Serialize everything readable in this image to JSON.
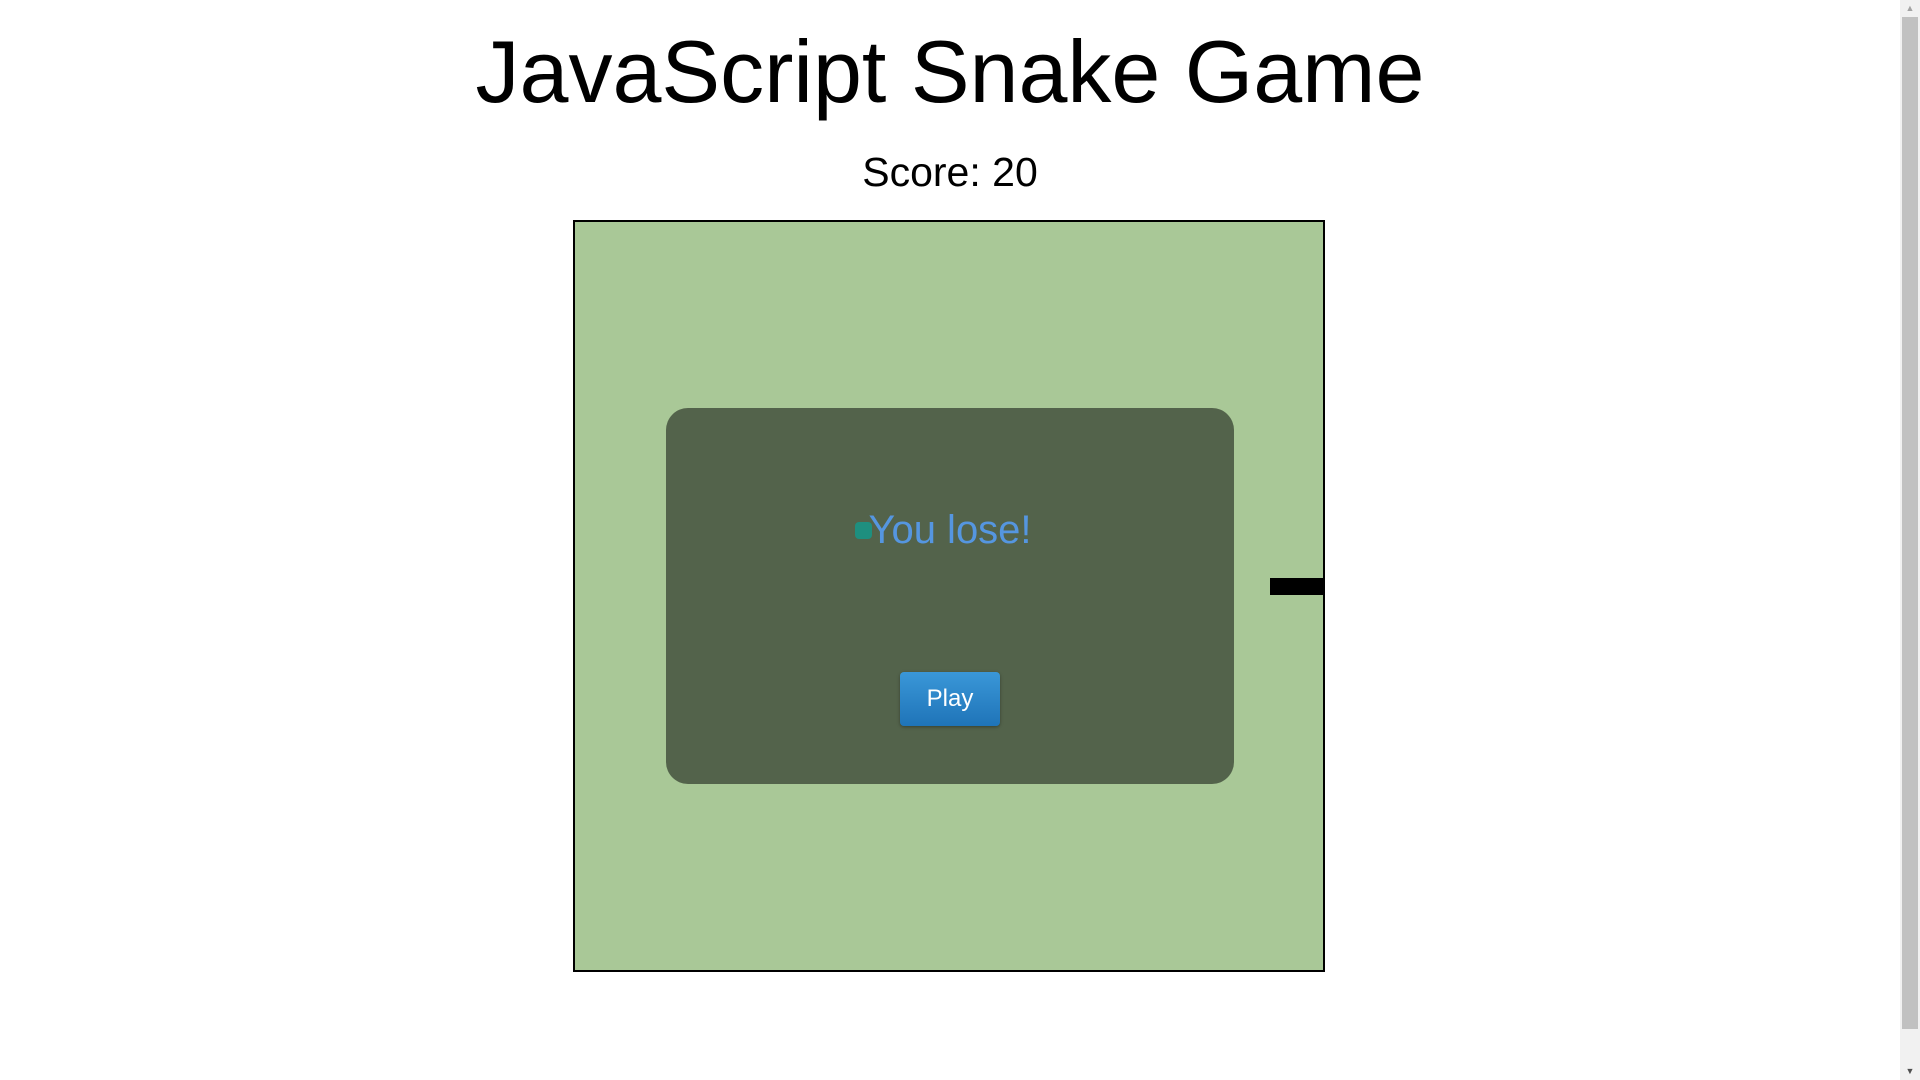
{
  "page": {
    "title": "JavaScript Snake Game",
    "score_label": "Score: 20",
    "score": 20
  },
  "game": {
    "status_text": "You lose!",
    "play_button_label": "Play"
  },
  "colors": {
    "board": "#a9c897",
    "overlay": "#53634b",
    "lose_text": "#5596e0",
    "food": "#1e8f7f",
    "snake": "#000000",
    "play_button": "#2a86c9"
  },
  "icons": {
    "scroll_up": "scroll-up-arrow-icon",
    "scroll_down": "scroll-down-arrow-icon"
  }
}
